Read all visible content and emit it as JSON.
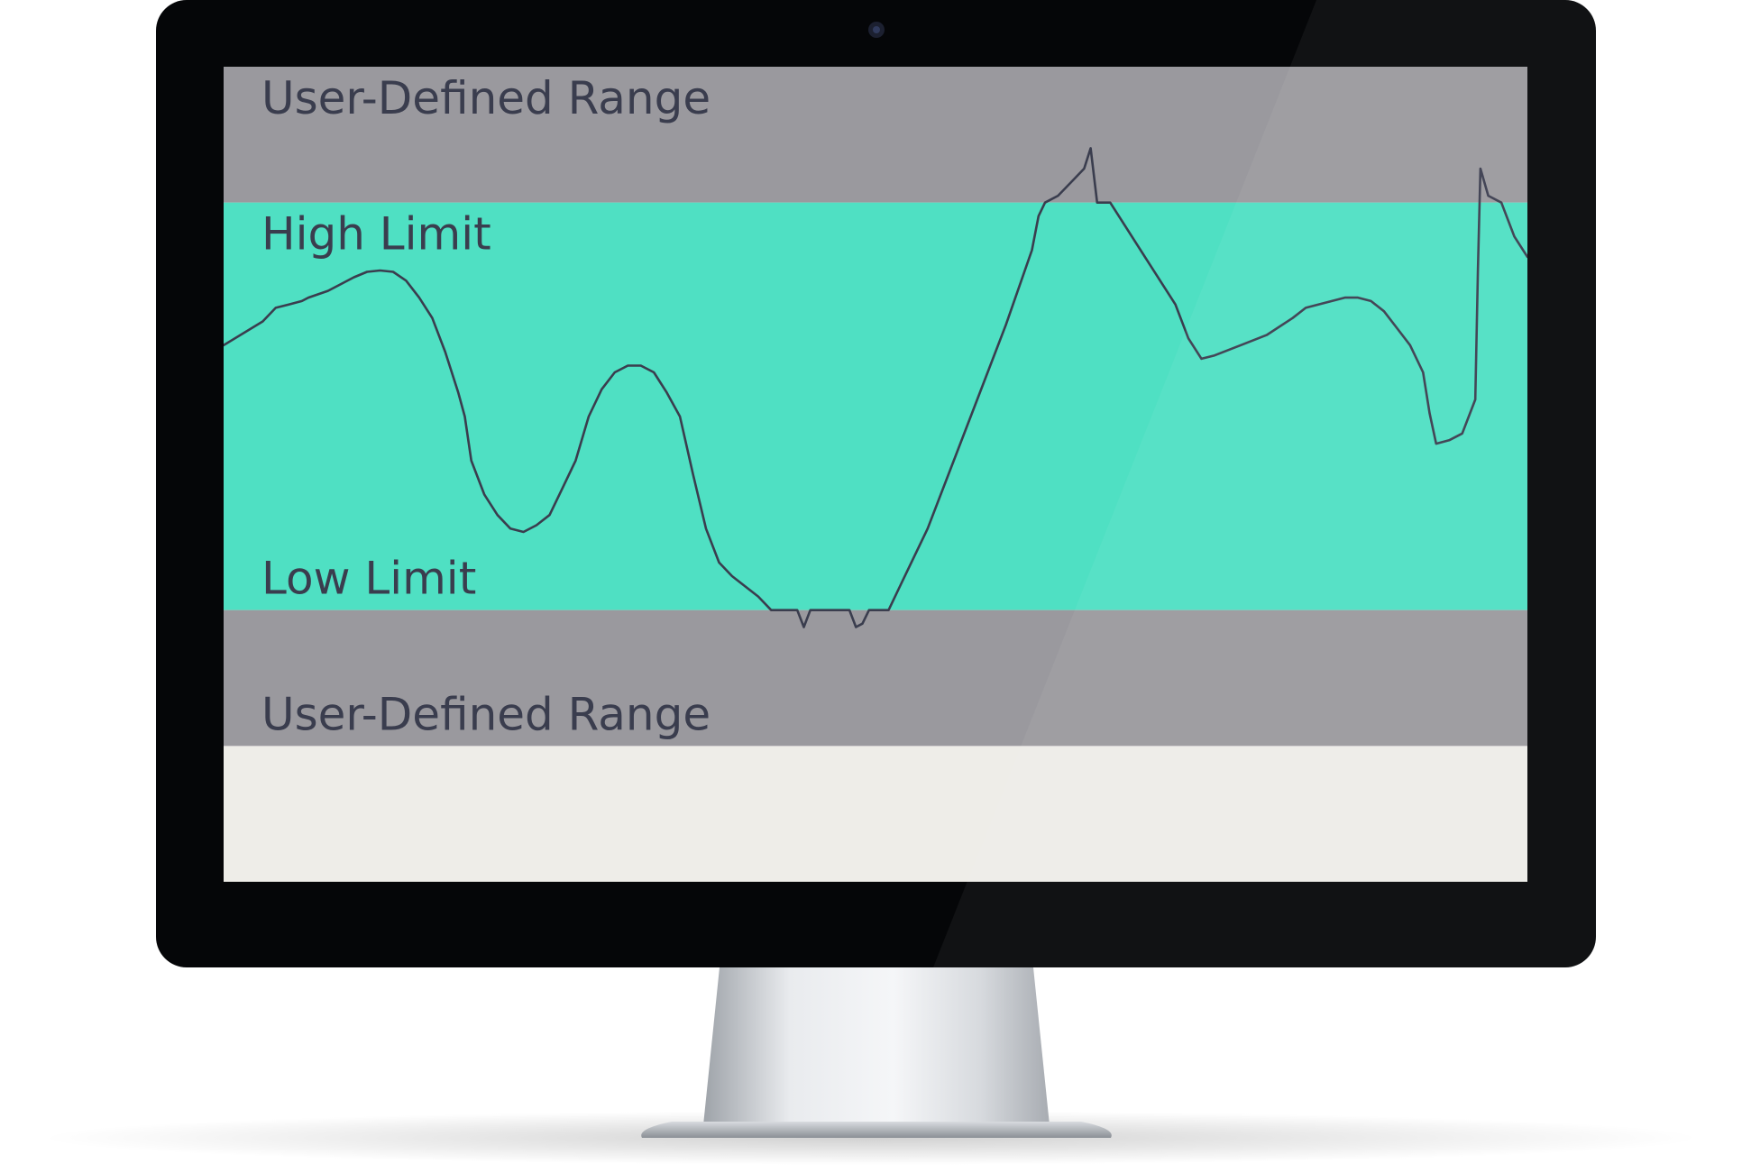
{
  "colors": {
    "outer_margin": "#eeede8",
    "user_range_band": "#9a999e",
    "normal_band": "#4fe0c3",
    "signal_line": "#3a3d4e",
    "label_text": "#3a3d4e",
    "bezel": "#050608"
  },
  "chart_data": {
    "type": "line",
    "title": "",
    "xlabel": "",
    "ylabel": "",
    "grid": false,
    "ylim": [
      0,
      120
    ],
    "bands": [
      {
        "label": "User-Defined Range",
        "from": 100,
        "to": 120,
        "color": "#9a999e"
      },
      {
        "label": "High Limit",
        "from": 40,
        "to": 100,
        "color": "#4fe0c3"
      },
      {
        "label": "Low Limit",
        "from": 40,
        "to": 100,
        "color": "#4fe0c3"
      },
      {
        "label": "User-Defined Range",
        "from": 20,
        "to": 40,
        "color": "#9a999e"
      }
    ],
    "limits": {
      "high": 100,
      "low": 40
    },
    "series": [
      {
        "values": [
          [
            0,
            79
          ],
          [
            3,
            82.5
          ],
          [
            4,
            84.5
          ],
          [
            5,
            85
          ],
          [
            6,
            85.5
          ],
          [
            6.5,
            86
          ],
          [
            8,
            87
          ],
          [
            10,
            89
          ],
          [
            11,
            89.8
          ],
          [
            12,
            90
          ],
          [
            13,
            89.8
          ],
          [
            14,
            88.5
          ],
          [
            15,
            86
          ],
          [
            16,
            83
          ],
          [
            17,
            78
          ],
          [
            18,
            72
          ],
          [
            18.5,
            68.5
          ],
          [
            19,
            62
          ],
          [
            20,
            57
          ],
          [
            21,
            54
          ],
          [
            22,
            52
          ],
          [
            23,
            51.5
          ],
          [
            24,
            52.5
          ],
          [
            25,
            54
          ],
          [
            26,
            58
          ],
          [
            27,
            62
          ],
          [
            28,
            68.5
          ],
          [
            29,
            72.5
          ],
          [
            30,
            75
          ],
          [
            31,
            76
          ],
          [
            32,
            76
          ],
          [
            33,
            75
          ],
          [
            34,
            72
          ],
          [
            35,
            68.5
          ],
          [
            36,
            60
          ],
          [
            37,
            52
          ],
          [
            38,
            47
          ],
          [
            39,
            45
          ],
          [
            41,
            42
          ],
          [
            42,
            40
          ],
          [
            44,
            40
          ],
          [
            44.5,
            37.5
          ],
          [
            45,
            40
          ],
          [
            48,
            40
          ],
          [
            48.5,
            37.5
          ],
          [
            49,
            38
          ],
          [
            49.5,
            40
          ],
          [
            51,
            40
          ],
          [
            52,
            44
          ],
          [
            54,
            52
          ],
          [
            56,
            62
          ],
          [
            58,
            72
          ],
          [
            60,
            82
          ],
          [
            62,
            93
          ],
          [
            62.5,
            98
          ],
          [
            63,
            100
          ],
          [
            64,
            101
          ],
          [
            65,
            103
          ],
          [
            66,
            105
          ],
          [
            66.5,
            108
          ],
          [
            67,
            100
          ],
          [
            68,
            100
          ],
          [
            70,
            94
          ],
          [
            72,
            88
          ],
          [
            73,
            85
          ],
          [
            74,
            80
          ],
          [
            75,
            77
          ],
          [
            76,
            77.5
          ],
          [
            78,
            79
          ],
          [
            80,
            80.5
          ],
          [
            82,
            83
          ],
          [
            83,
            84.5
          ],
          [
            85,
            85.5
          ],
          [
            86,
            86
          ],
          [
            87,
            86
          ],
          [
            88,
            85.5
          ],
          [
            89,
            84
          ],
          [
            90,
            81.5
          ],
          [
            91,
            79
          ],
          [
            92,
            75
          ],
          [
            92.5,
            69
          ],
          [
            93,
            64.5
          ],
          [
            94,
            65
          ],
          [
            95,
            66
          ],
          [
            96,
            71
          ],
          [
            96.2,
            90
          ],
          [
            96.4,
            105
          ],
          [
            97,
            101
          ],
          [
            98,
            100
          ],
          [
            99,
            95
          ],
          [
            100,
            92
          ]
        ]
      }
    ]
  }
}
